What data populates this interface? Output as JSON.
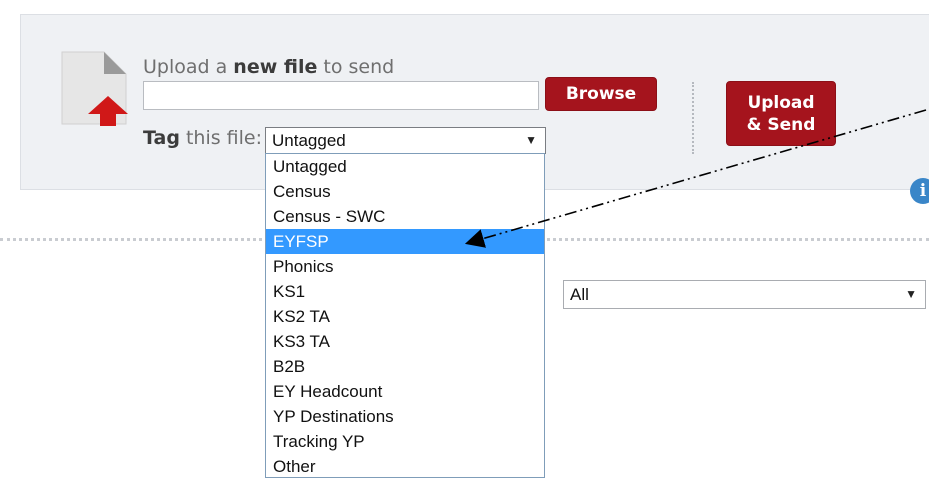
{
  "upload": {
    "label_prefix": "Upload a ",
    "label_bold": "new file",
    "label_suffix": " to send",
    "file_value": "",
    "browse_label": "Browse",
    "send_line1": "Upload",
    "send_line2": "& Send"
  },
  "tag": {
    "label_bold": "Tag",
    "label_rest": " this file:",
    "selected": "Untagged",
    "options": [
      "Untagged",
      "Census",
      "Census - SWC",
      "EYFSP",
      "Phonics",
      "KS1",
      "KS2 TA",
      "KS3 TA",
      "B2B",
      "EY Headcount",
      "YP Destinations",
      "Tracking YP",
      "Other"
    ],
    "highlighted": "EYFSP"
  },
  "filter": {
    "selected": "All"
  },
  "icons": {
    "file": "file-upload-icon",
    "info": "info-icon",
    "dropdown_arrow": "chevron-down-icon"
  },
  "colors": {
    "accent_red": "#a5141d",
    "highlight_blue": "#3399ff",
    "panel_bg": "#eff1f4"
  }
}
